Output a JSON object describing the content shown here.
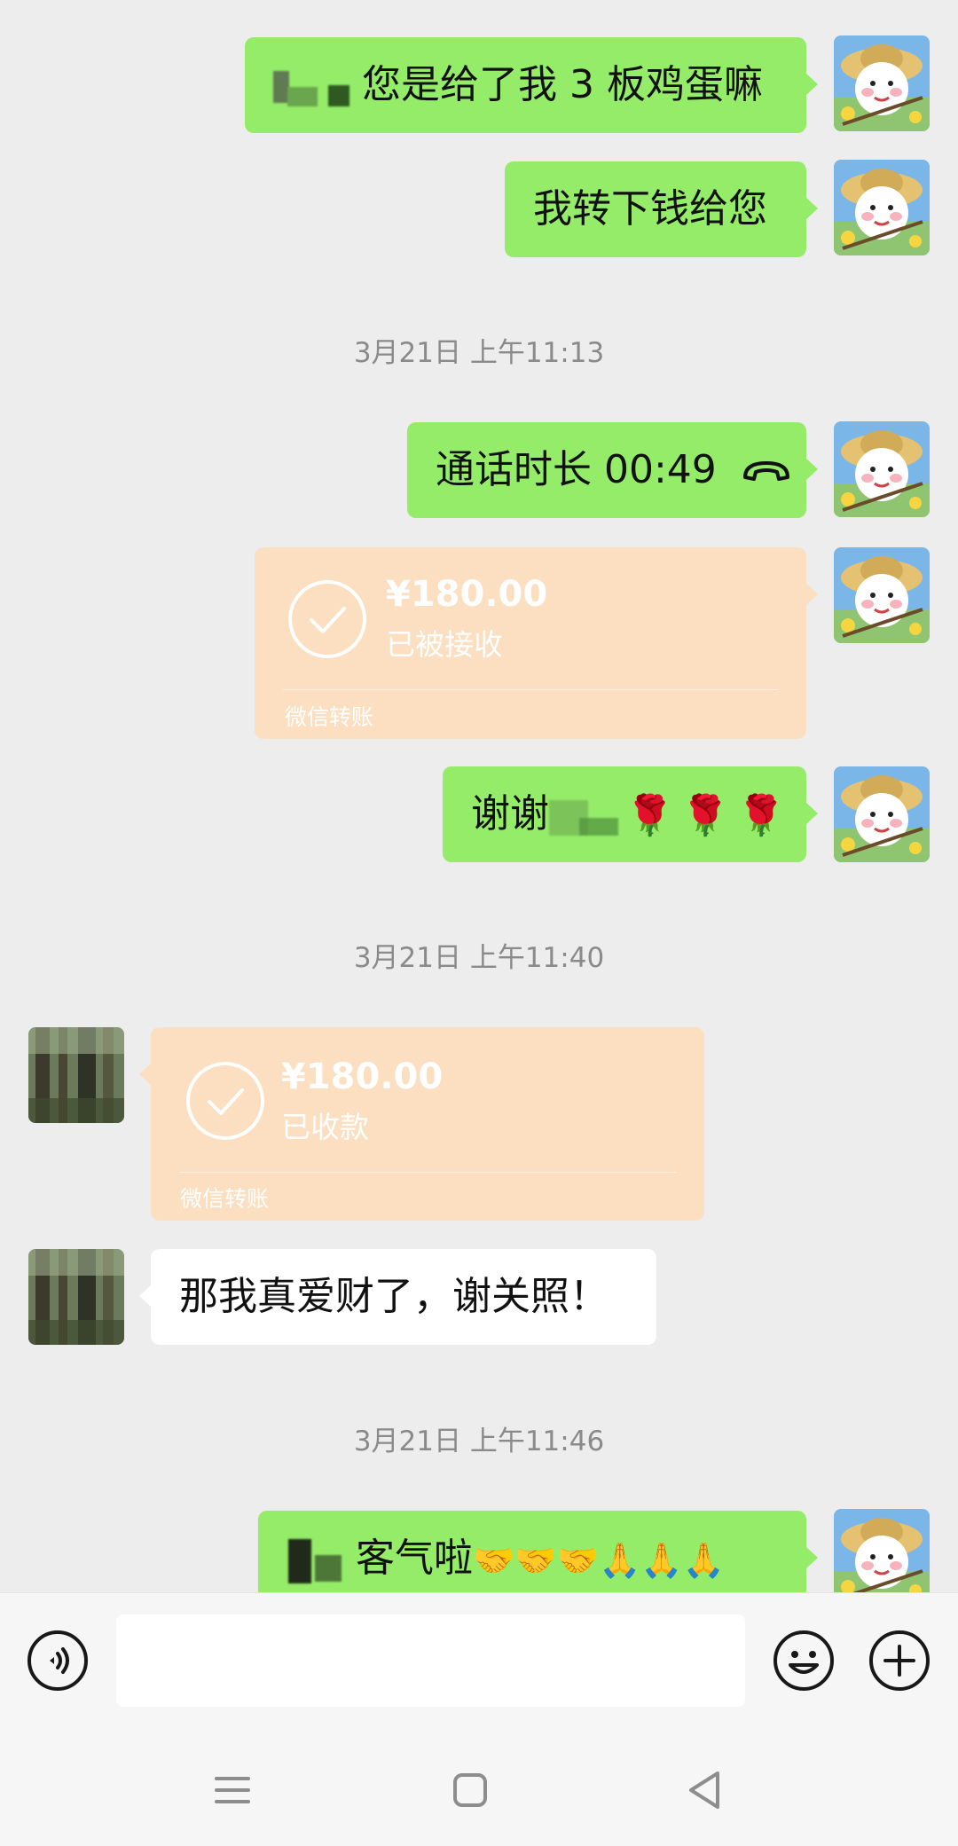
{
  "colors": {
    "background": "#ededed",
    "sent_bubble": "#95ec69",
    "received_bubble": "#ffffff",
    "transfer_card": "#fbdfc0",
    "timestamp": "#8a8a8a"
  },
  "messages": {
    "m1": {
      "text": "您是给了我 3 板鸡蛋嘛"
    },
    "m2": {
      "text": "我转下钱给您"
    },
    "time1": "3月21日 上午11:13",
    "call": {
      "text": "通话时长 00:49",
      "icon": "phone-hangup-icon"
    },
    "transfer1": {
      "amount": "¥180.00",
      "status": "已被接收",
      "footer": "微信转账",
      "icon": "check-circle-icon"
    },
    "thanks": {
      "text": "谢谢",
      "emojis": "🌹🌹🌹"
    },
    "time2": "3月21日 上午11:40",
    "transfer2": {
      "amount": "¥180.00",
      "status": "已收款",
      "footer": "微信转账",
      "icon": "check-circle-icon"
    },
    "reply": {
      "text": "那我真爱财了，谢关照！"
    },
    "time3": "3月21日 上午11:46",
    "last": {
      "text": "客气啦",
      "emojis": "🤝🤝🤝🙏🙏🙏"
    }
  },
  "input_bar": {
    "voice_icon": "voice-icon",
    "input_value": "",
    "emoji_icon": "emoji-icon",
    "plus_icon": "plus-icon"
  },
  "nav_bar": {
    "menu_icon": "menu-icon",
    "home_icon": "home-icon",
    "back_icon": "back-icon"
  }
}
